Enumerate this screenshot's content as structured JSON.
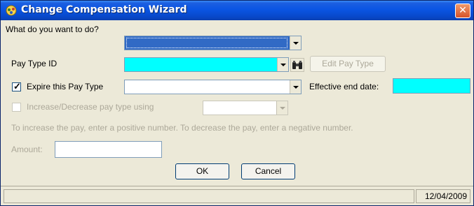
{
  "window": {
    "title": "Change Compensation Wizard",
    "icon": "wizard-app-icon",
    "close_icon": "close-icon"
  },
  "form": {
    "action_label": "What do you want to do?",
    "action_value": "",
    "pay_type_id_label": "Pay Type ID",
    "pay_type_id_value": "",
    "lookup_icon": "binoculars-icon",
    "edit_pay_type_label": "Edit Pay Type",
    "expire_label": "Expire this Pay Type",
    "expire_checked": true,
    "expire_value": "",
    "effective_end_date_label": "Effective end date:",
    "effective_end_date_value": "",
    "increase_label": "Increase/Decrease pay type using",
    "increase_checked": false,
    "increase_value": "",
    "hint_text": "To increase the pay, enter a positive number. To decrease the pay, enter a negative number.",
    "amount_label": "Amount:",
    "amount_value": ""
  },
  "buttons": {
    "ok_label": "OK",
    "cancel_label": "Cancel"
  },
  "statusbar": {
    "message": "",
    "date": "12/04/2009"
  },
  "colors": {
    "titlebar": "#0a55e3",
    "required_field": "#00ffff",
    "selection": "#316ac5",
    "disabled_text": "#aca899"
  }
}
